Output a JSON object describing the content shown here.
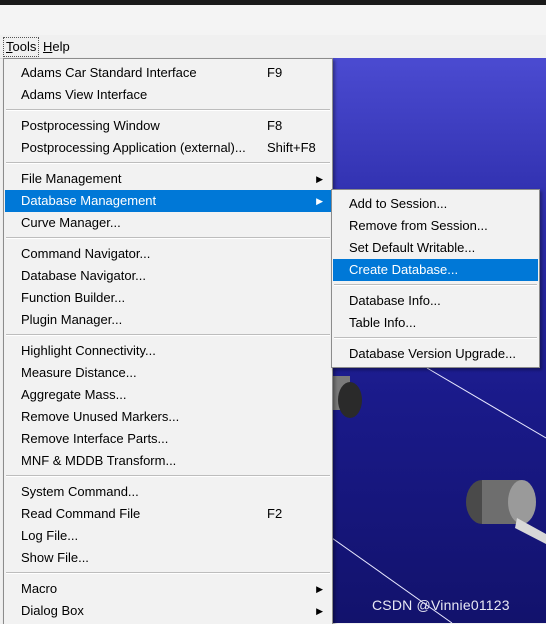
{
  "menubar": {
    "items": [
      {
        "label": "Tools",
        "underline": "T"
      },
      {
        "label": "Help",
        "underline": "H"
      }
    ]
  },
  "tools_menu": {
    "items": [
      {
        "label": "Adams Car Standard Interface",
        "shortcut": "F9"
      },
      {
        "label": "Adams View Interface",
        "shortcut": ""
      },
      {
        "label": "Postprocessing Window",
        "shortcut": "F8"
      },
      {
        "label": "Postprocessing Application (external)...",
        "shortcut": "Shift+F8"
      },
      {
        "label": "File Management",
        "submenu": true
      },
      {
        "label": "Database Management",
        "submenu": true,
        "highlighted": true
      },
      {
        "label": "Curve Manager..."
      },
      {
        "label": "Command Navigator..."
      },
      {
        "label": "Database Navigator..."
      },
      {
        "label": "Function Builder..."
      },
      {
        "label": "Plugin Manager..."
      },
      {
        "label": "Highlight Connectivity..."
      },
      {
        "label": "Measure Distance..."
      },
      {
        "label": "Aggregate Mass..."
      },
      {
        "label": "Remove Unused Markers..."
      },
      {
        "label": "Remove Interface Parts..."
      },
      {
        "label": "MNF & MDDB Transform..."
      },
      {
        "label": "System Command..."
      },
      {
        "label": "Read Command File",
        "shortcut": "F2"
      },
      {
        "label": "Log File..."
      },
      {
        "label": "Show File..."
      },
      {
        "label": "Macro",
        "submenu": true
      },
      {
        "label": "Dialog Box",
        "submenu": true
      }
    ]
  },
  "database_submenu": {
    "items": [
      {
        "label": "Add to Session..."
      },
      {
        "label": "Remove from Session..."
      },
      {
        "label": "Set Default Writable..."
      },
      {
        "label": "Create Database...",
        "highlighted": true
      },
      {
        "label": "Database Info..."
      },
      {
        "label": "Table Info..."
      },
      {
        "label": "Database Version Upgrade..."
      }
    ]
  },
  "icons": {
    "submenu_arrow": "submenu-arrow-icon"
  },
  "colors": {
    "highlight": "#0078d7",
    "viewport": "#1a1a8a"
  },
  "watermark": "CSDN @Vinnie01123"
}
